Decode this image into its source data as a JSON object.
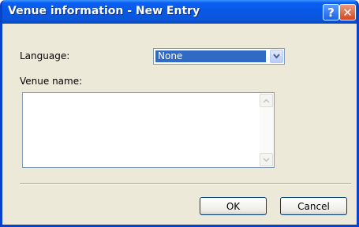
{
  "window": {
    "title": "Venue information - New Entry",
    "help_glyph": "?",
    "close_glyph": "✕"
  },
  "form": {
    "language_label": "Language:",
    "language_value": "None",
    "venue_name_label": "Venue name:",
    "venue_name_value": ""
  },
  "buttons": {
    "ok_label": "OK",
    "cancel_label": "Cancel"
  },
  "icons": {
    "dropdown": "chevron-down-icon",
    "scroll_up": "arrow-up-icon",
    "scroll_down": "arrow-down-icon"
  },
  "colors": {
    "titlebar": "#0858e7",
    "selection": "#316ac5",
    "dialog_face": "#ece9d8",
    "close_button": "#d6461e"
  }
}
